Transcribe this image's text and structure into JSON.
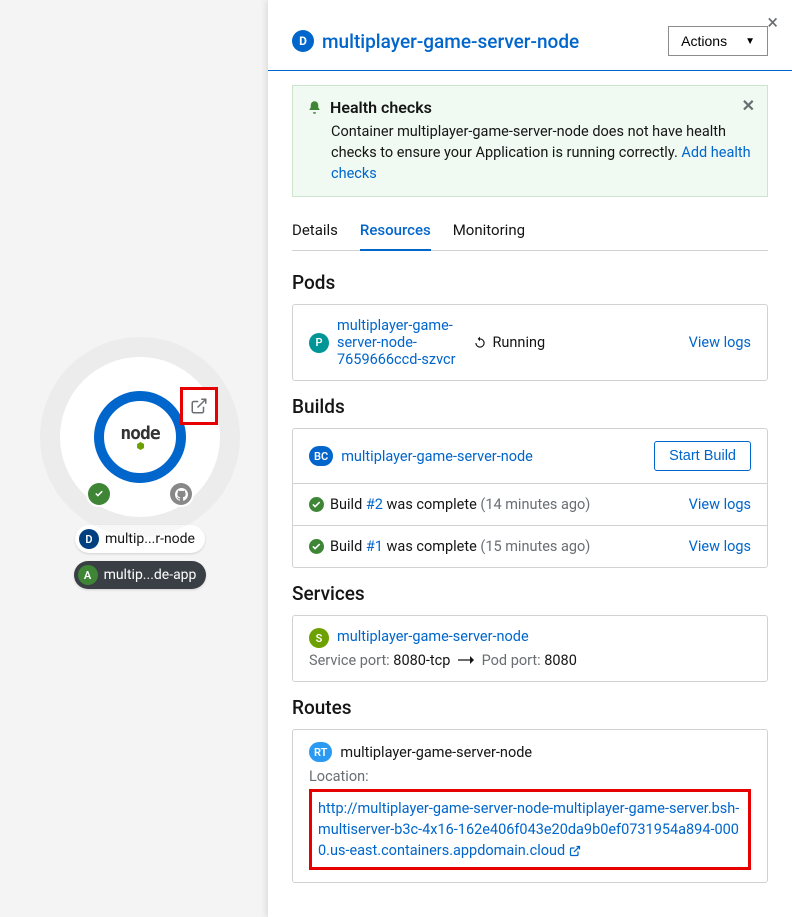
{
  "canvas": {
    "node_label": "multip...r-node",
    "app_label": "multip...de-app",
    "node_logo_text": "node"
  },
  "panel": {
    "title": "multiplayer-game-server-node",
    "badge_letter": "D",
    "actions_label": "Actions"
  },
  "alert": {
    "title": "Health checks",
    "body_prefix": "Container multiplayer-game-server-node does not have health checks to ensure your Application is running correctly. ",
    "link": "Add health checks"
  },
  "tabs": {
    "details": "Details",
    "resources": "Resources",
    "monitoring": "Monitoring"
  },
  "sections": {
    "pods": "Pods",
    "builds": "Builds",
    "services": "Services",
    "routes": "Routes"
  },
  "pods": {
    "items": [
      {
        "badge": "P",
        "name": "multiplayer-game-server-node-7659666ccd-szvcr",
        "status": "Running",
        "log_link": "View logs"
      }
    ]
  },
  "builds": {
    "config": {
      "badge": "BC",
      "name": "multiplayer-game-server-node",
      "start_label": "Start Build"
    },
    "runs": [
      {
        "prefix": "Build ",
        "num": "#2",
        "suffix": " was complete ",
        "time": "(14 minutes ago)",
        "log_link": "View logs"
      },
      {
        "prefix": "Build ",
        "num": "#1",
        "suffix": " was complete ",
        "time": "(15 minutes ago)",
        "log_link": "View logs"
      }
    ]
  },
  "services": {
    "item": {
      "badge": "S",
      "name": "multiplayer-game-server-node",
      "svc_port_label": "Service port: ",
      "svc_port": "8080-tcp",
      "pod_port_label": "Pod port: ",
      "pod_port": "8080"
    }
  },
  "routes": {
    "item": {
      "badge": "RT",
      "name": "multiplayer-game-server-node",
      "location_label": "Location:",
      "url": "http://multiplayer-game-server-node-multiplayer-game-server.bsh-multiserver-b3c-4x16-162e406f043e20da9b0ef0731954a894-0000.us-east.containers.appdomain.cloud"
    }
  }
}
